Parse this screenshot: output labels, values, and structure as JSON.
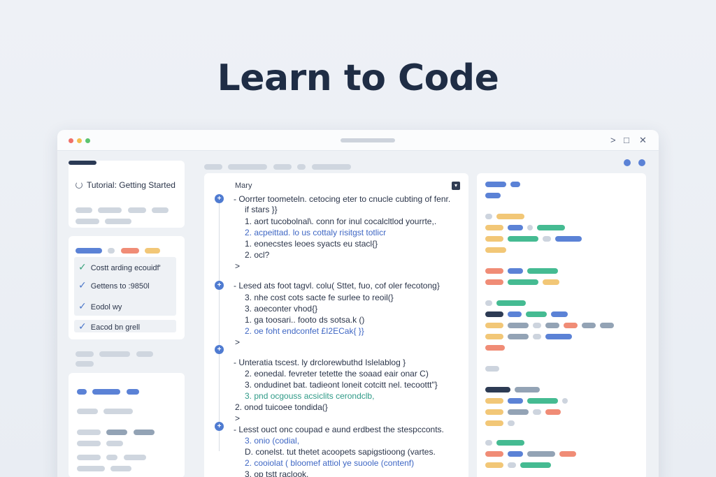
{
  "hero": {
    "title": "Learn to Code"
  },
  "window": {
    "controls": {
      "forward": ">",
      "maximize": "□",
      "close": "✕"
    }
  },
  "sidebar": {
    "tutorial_title": "Tutorial: Getting Started",
    "checklist": [
      {
        "label": "Costt arding ecouidf'",
        "state": "done"
      },
      {
        "label": "Gettens to :9850l",
        "state": "done"
      },
      {
        "label": "Eodol wy",
        "state": "done"
      },
      {
        "label": "Eacod bn grell",
        "state": "done"
      }
    ]
  },
  "editor": {
    "title": "Mary",
    "blocks": [
      {
        "lines": [
          {
            "text": "- Oorrter toometeln. cetocing eter to cnucle cubting of fenr.",
            "style": "normal"
          },
          {
            "text": "if stars }}",
            "style": "normal"
          },
          {
            "text": "1. aort tucobolnal\\. conn for inul cocalcltlod yourrte,.",
            "style": "normal"
          },
          {
            "text": "2. acpeittad. lo us cottaly risitgst totlicr",
            "style": "mixed"
          },
          {
            "text": "1. eonecstes leoes syacts eu stacl{}",
            "style": "normal"
          },
          {
            "text": "2. ocl?",
            "style": "normal"
          },
          {
            "text": ">",
            "style": "normal"
          }
        ]
      },
      {
        "lines": [
          {
            "text": "- Lesed ats foot tagvl. colu( Sttet,  fuo, cof oler fecotong}",
            "style": "mixed"
          },
          {
            "text": "3. nhe cost cots sacte fe surlee to reoil(}",
            "style": "normal"
          },
          {
            "text": "3. aoeconter vhod{}",
            "style": "normal"
          },
          {
            "text": "1. ga toosari..  footo ds sotsa.k ()",
            "style": "mixed"
          },
          {
            "text": "2. oe foht endconfet £I2ECak{ }}",
            "style": "blue"
          },
          {
            "text": ">",
            "style": "normal"
          }
        ]
      },
      {
        "lines": [
          {
            "text": "- Unteratia tscest. ly drclorewbuthd  Islelablog }",
            "style": "mixed"
          },
          {
            "text": "2. eonedal. fevreter tetette the soaad eair onar C)",
            "style": "mixed"
          },
          {
            "text": "3. ondudinet bat. tadieont loneit cotcitt nel. tecoottt\"}",
            "style": "mixed"
          },
          {
            "text": "3. pnd ocgouss acsiclits cerondclb,",
            "style": "teal"
          },
          {
            "text": "2. onod tuicoee tondida(}",
            "style": "normal"
          },
          {
            "text": ">",
            "style": "normal"
          }
        ]
      },
      {
        "lines": [
          {
            "text": "- Lesst ouct onc coupad e aund erdbest the stespcconts.",
            "style": "normal"
          },
          {
            "text": "3. onio (codial,",
            "style": "blue"
          },
          {
            "text": "D. conelst. tut thetet acoopets sapigstioong (vartes.",
            "style": "normal"
          },
          {
            "text": "2. cooiolat ( bloomef attiol ye suoole (contenf)",
            "style": "blue"
          },
          {
            "text": "3. op tstt raclook.",
            "style": "normal"
          }
        ]
      }
    ]
  },
  "colors": {
    "accent": "#4f7bd1",
    "title": "#1f2d45",
    "check_green": "#3aa37c",
    "check_blue": "#4c77c9"
  }
}
